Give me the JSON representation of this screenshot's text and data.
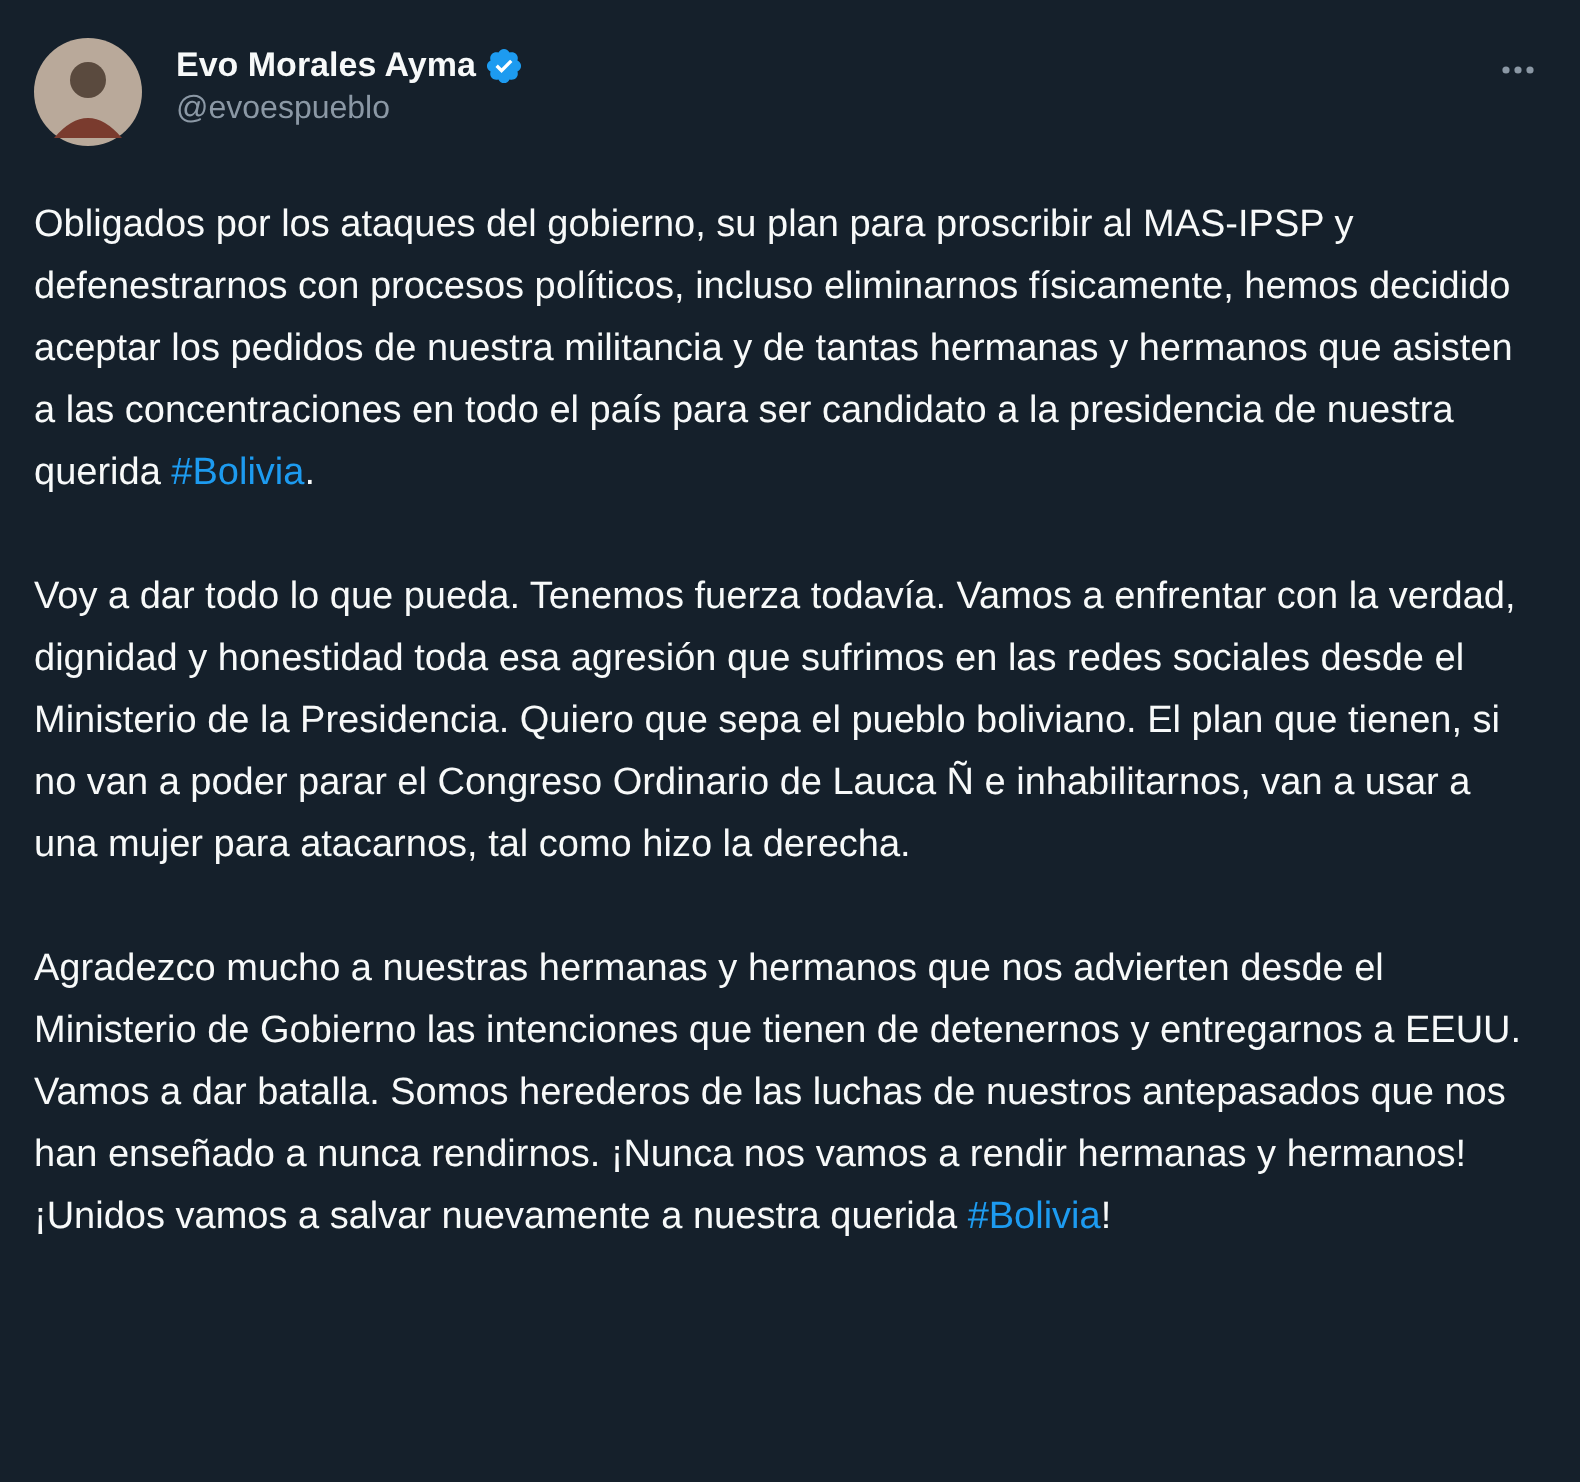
{
  "author": {
    "name": "Evo Morales Ayma",
    "handle": "@evoespueblo",
    "verified": true
  },
  "paragraphs": [
    [
      {
        "kind": "text",
        "text": "Obligados por los ataques del gobierno, su plan para proscribir al MAS-IPSP y defenestrarnos con procesos políticos, incluso eliminarnos físicamente, hemos decidido aceptar los pedidos de nuestra militancia y de tantas hermanas y hermanos que asisten a las concentraciones en todo el país para ser candidato a la presidencia de nuestra querida "
      },
      {
        "kind": "hashtag",
        "text": "#Bolivia"
      },
      {
        "kind": "text",
        "text": "."
      }
    ],
    [
      {
        "kind": "text",
        "text": "Voy a dar todo lo que pueda. Tenemos fuerza todavía. Vamos a enfrentar con la verdad, dignidad y honestidad toda esa agresión que sufrimos en las redes sociales desde el Ministerio de la Presidencia. Quiero que sepa el pueblo boliviano. El plan que tienen, si no van a poder parar el Congreso Ordinario de Lauca Ñ e inhabilitarnos, van a usar a una mujer para atacarnos, tal como hizo la derecha."
      }
    ],
    [
      {
        "kind": "text",
        "text": "Agradezco mucho a nuestras hermanas y hermanos que nos advierten desde el Ministerio de Gobierno las intenciones que tienen de detenernos y entregarnos a EEUU. Vamos a dar batalla. Somos herederos de las luchas de nuestros antepasados que nos han enseñado a nunca rendirnos. ¡Nunca nos vamos a rendir hermanas y hermanos! ¡Unidos vamos a salvar nuevamente a nuestra querida "
      },
      {
        "kind": "hashtag",
        "text": "#Bolivia"
      },
      {
        "kind": "text",
        "text": "!"
      }
    ]
  ]
}
